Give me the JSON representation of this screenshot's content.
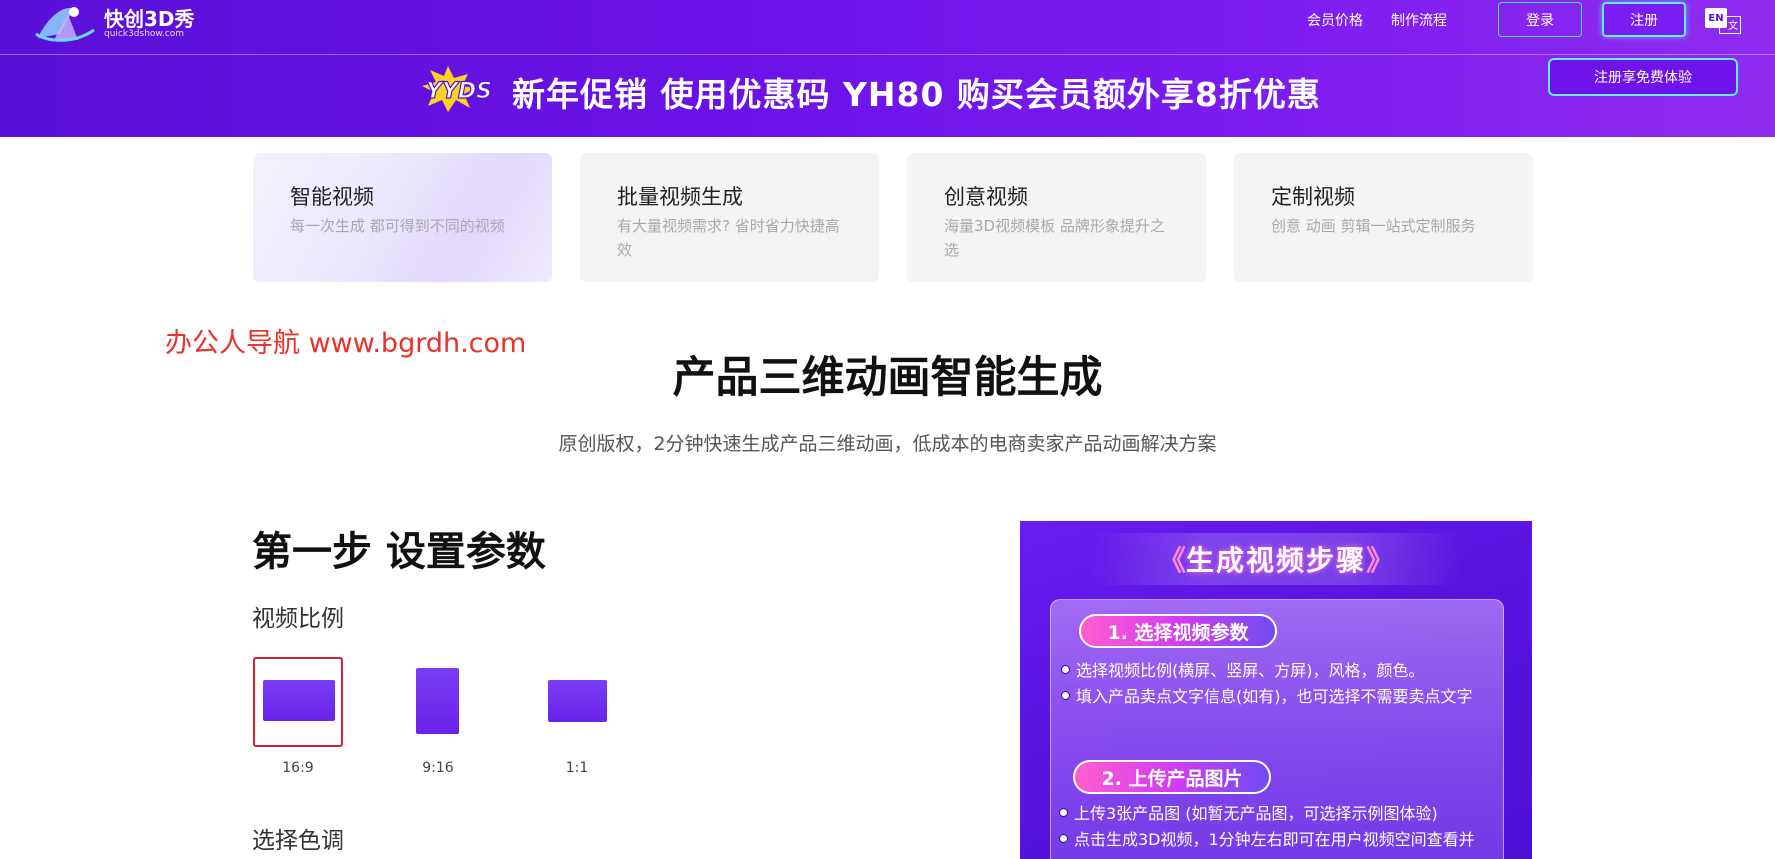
{
  "header": {
    "logo_text": "快创3D秀",
    "logo_sub": "quick3dshow.com",
    "nav": [
      "会员价格",
      "制作流程"
    ],
    "login_label": "登录",
    "register_label": "注册",
    "lang_en": "EN",
    "lang_zh": "文",
    "trial_label": "注册享免费体验"
  },
  "banner": {
    "badge": "YYDS",
    "text": "新年促销 使用优惠码 YH80  购买会员额外享8折优惠"
  },
  "cards": [
    {
      "title": "智能视频",
      "desc": "每一次生成 都可得到不同的视频"
    },
    {
      "title": "批量视频生成",
      "desc": "有大量视频需求? 省时省力快捷高效"
    },
    {
      "title": "创意视频",
      "desc": "海量3D视频模板  品牌形象提升之选"
    },
    {
      "title": "定制视频",
      "desc": "创意 动画 剪辑一站式定制服务"
    }
  ],
  "watermark": "办公人导航 www.bgrdh.com",
  "hero": {
    "title": "产品三维动画智能生成",
    "subtitle": "原创版权，2分钟快速生成产品三维动画，低成本的电商卖家产品动画解决方案"
  },
  "step1": {
    "title": "第一步 设置参数",
    "ratio_label": "视频比例",
    "ratios": [
      "16:9",
      "9:16",
      "1:1"
    ],
    "selected_ratio": "16:9",
    "tone_label": "选择色调"
  },
  "guide": {
    "title": "生成视频步骤",
    "step1_pill": "1. 选择视频参数",
    "step1_items": [
      "选择视频比例(横屏、竖屏、方屏)，风格，颜色。",
      "填入产品卖点文字信息(如有)，也可选择不需要卖点文字"
    ],
    "step2_pill": "2. 上传产品图片",
    "step2_items": [
      "上传3张产品图 (如暂无产品图，可选择示例图体验)",
      "点击生成3D视频，1分钟左右即可在用户视频空间查看并"
    ]
  },
  "colors": {
    "brand_purple": "#6a12e6",
    "accent_cyan": "#5ff0ff",
    "selected_red": "#d0203c",
    "watermark_red": "#e8322a"
  }
}
